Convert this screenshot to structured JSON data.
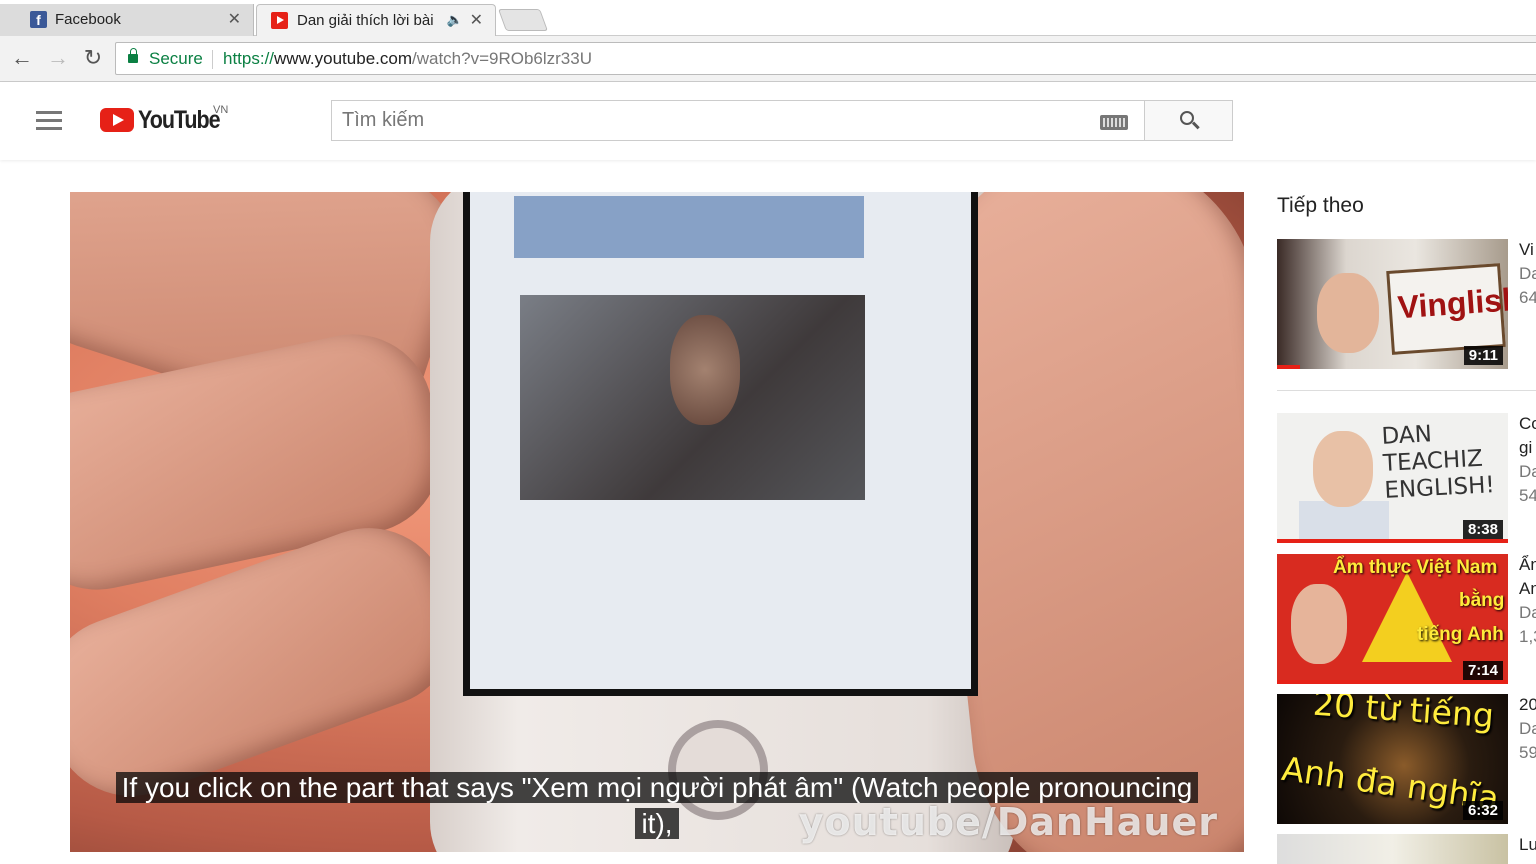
{
  "browser": {
    "tabs": [
      {
        "title": "Facebook",
        "active": false,
        "icon": "facebook-icon"
      },
      {
        "title": "Dan giải thích lời bài h",
        "active": true,
        "icon": "youtube-icon",
        "audio": true
      }
    ],
    "secure_label": "Secure",
    "url": {
      "scheme": "https://",
      "host": "www.youtube.com",
      "path": "/watch?v=9ROb6lzr33U"
    }
  },
  "masthead": {
    "logo_text": "YouTube",
    "country": "VN",
    "search_placeholder": "Tìm kiếm"
  },
  "player": {
    "subtitle_line1": "If you click on the part that says \"Xem mọi người phát âm\" (Watch people pronouncing",
    "subtitle_line2": "it),",
    "watermark": "youtube/DanHauer"
  },
  "sidebar": {
    "up_next_label": "Tiếp theo",
    "videos": [
      {
        "duration": "9:11",
        "thumb_text": "Vinglish",
        "meta_title": "Vi",
        "meta_channel": "Da",
        "meta_views": "64",
        "watched_fraction": 0.1
      },
      {
        "duration": "8:38",
        "thumb_text_lines": [
          "DAN",
          "TEACHIZ",
          "ENGLISH!"
        ],
        "meta_title": "Co",
        "meta_title2": "gi",
        "meta_channel": "Da",
        "meta_views": "54",
        "watched_fraction": 1.0
      },
      {
        "duration": "7:14",
        "thumb_text_lines": [
          "Ẩm thực Việt Nam",
          "bằng",
          "tiếng Anh"
        ],
        "meta_title": "Ẩn",
        "meta_title2": "An",
        "meta_channel": "Da",
        "meta_views": "1,3",
        "watched_fraction": 1.0
      },
      {
        "duration": "6:32",
        "thumb_text_lines": [
          "20 từ tiếng",
          "Anh đa nghĩa"
        ],
        "meta_title": "20",
        "meta_channel": "Da",
        "meta_views": "59"
      },
      {
        "meta_title": "Lu"
      }
    ]
  },
  "colors": {
    "youtube_red": "#e62117",
    "secure_green": "#0b8043"
  }
}
